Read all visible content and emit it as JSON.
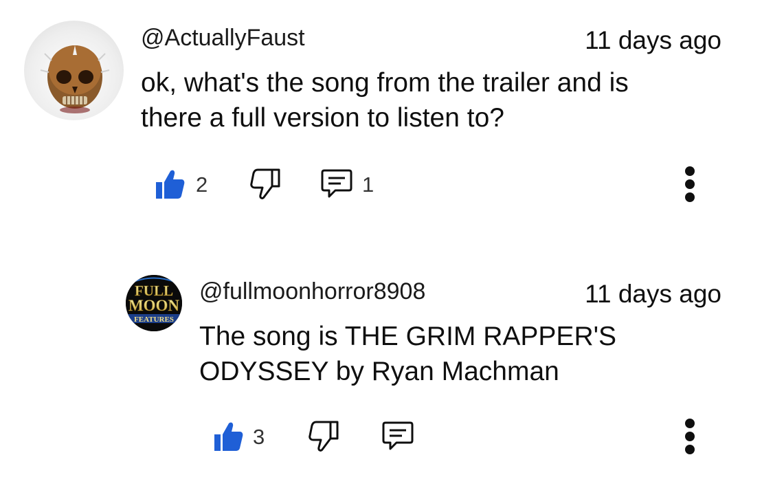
{
  "comments": [
    {
      "author": "@ActuallyFaust",
      "time": "11 days ago",
      "text": "ok, what's the song from the trailer and is there a full version to listen to?",
      "likes": "2",
      "replies": "1",
      "avatar_icon": "skull-avatar-icon"
    },
    {
      "author": "@fullmoonhorror8908",
      "time": "11 days ago",
      "text": "The song is THE GRIM RAPPER'S ODYSSEY by Ryan Machman",
      "likes": "3",
      "avatar_icon": "full-moon-features-logo-icon",
      "avatar_logo_lines": [
        "FULL",
        "MOON",
        "FEATURES"
      ]
    }
  ],
  "colors": {
    "like_blue": "#1f5fd6",
    "icon_dark": "#0f0f0f",
    "count_gray": "#333333"
  }
}
